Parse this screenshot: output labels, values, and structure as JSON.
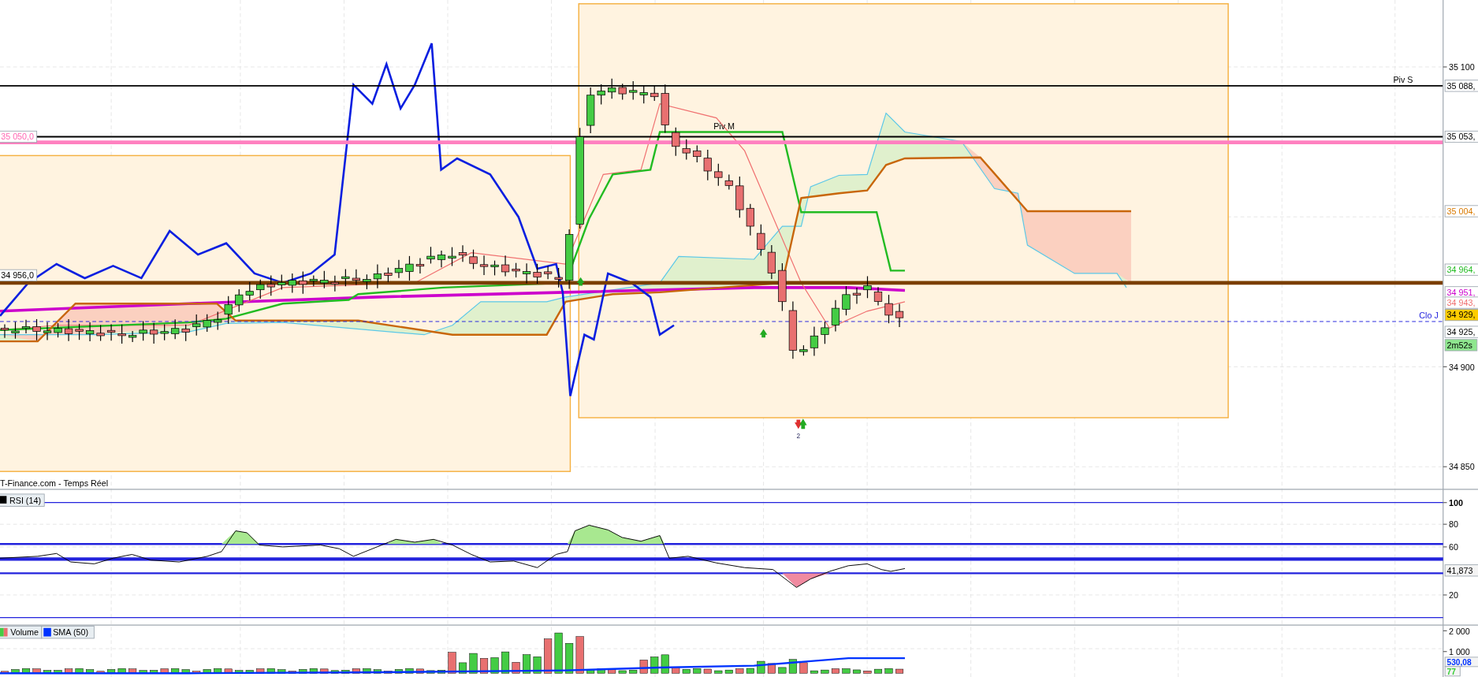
{
  "price_pane": {
    "source": "T-Finance.com - Temps Réel",
    "axis_ticks": [
      "35 100",
      "34 900",
      "34 850"
    ],
    "tags": [
      {
        "text": "35 088,",
        "kind": "level",
        "color": "#000000"
      },
      {
        "text": "35 053,",
        "kind": "level",
        "color": "#000000"
      },
      {
        "text": "35 004,",
        "kind": "level",
        "color": "#d97a00"
      },
      {
        "text": "34 964,",
        "kind": "level",
        "color": "#22bb22"
      },
      {
        "text": "34 951,",
        "kind": "level",
        "color": "#cc00cc"
      },
      {
        "text": "34 943,",
        "kind": "level",
        "color": "#f07070"
      },
      {
        "text": "34 929,",
        "kind": "current"
      },
      {
        "text": "34 925,",
        "kind": "level",
        "color": "#000000"
      },
      {
        "text": "2m52s",
        "kind": "timer"
      }
    ],
    "left_tags": [
      {
        "text": "35 050,0",
        "color": "#ff69b4"
      },
      {
        "text": "34 956,0",
        "color": "#000000"
      }
    ],
    "line_labels": [
      "Piv S",
      "Piv M",
      "Clo J"
    ],
    "signal_label": "2"
  },
  "rsi_pane": {
    "legend": "RSI (14)",
    "axis_ticks": [
      "100",
      "80",
      "60",
      "20"
    ],
    "value_tag": "41,873"
  },
  "volume_pane": {
    "legend": [
      {
        "label": "Volume",
        "kind": "volume"
      },
      {
        "label": "SMA (50)",
        "kind": "line",
        "color": "#0033ff"
      }
    ],
    "axis_ticks": [
      "2 000",
      "1 000"
    ],
    "tags": [
      {
        "text": "530,08",
        "color": "#0033ff"
      },
      {
        "text": "77",
        "color": "#33cc33"
      }
    ]
  }
}
